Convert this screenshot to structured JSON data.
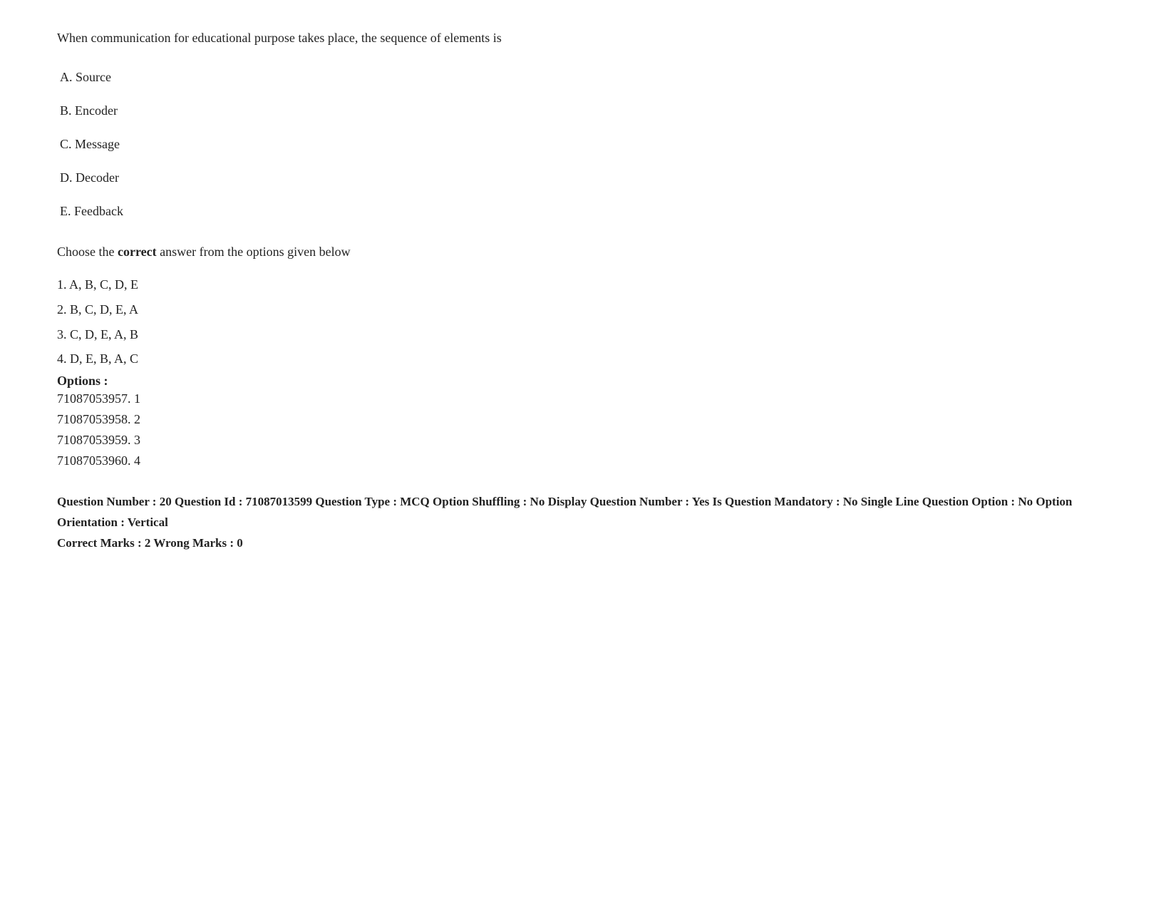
{
  "question": {
    "text": "When communication for educational purpose takes place, the sequence of elements is",
    "options": [
      {
        "label": "A.",
        "text": "Source"
      },
      {
        "label": "B.",
        "text": "Encoder"
      },
      {
        "label": "C.",
        "text": "Message"
      },
      {
        "label": "D.",
        "text": "Decoder"
      },
      {
        "label": "E.",
        "text": "Feedback"
      }
    ],
    "instruction_prefix": "Choose the ",
    "instruction_bold": "correct",
    "instruction_suffix": " answer from the options given below",
    "answer_choices": [
      {
        "num": "1.",
        "text": "A, B, C, D, E"
      },
      {
        "num": "2.",
        "text": "B, C, D, E, A"
      },
      {
        "num": "3.",
        "text": "C, D, E, A, B"
      },
      {
        "num": "4.",
        "text": "D, E, B, A, C"
      }
    ],
    "options_label": "Options :",
    "option_ids": [
      {
        "id": "71087053957.",
        "num": "1"
      },
      {
        "id": "71087053958.",
        "num": "2"
      },
      {
        "id": "71087053959.",
        "num": "3"
      },
      {
        "id": "71087053960.",
        "num": "4"
      }
    ],
    "metadata_line1": "Question Number : 20 Question Id : 71087013599 Question Type : MCQ Option Shuffling : No Display Question Number : Yes Is Question Mandatory : No Single Line Question Option : No Option Orientation : Vertical",
    "marks_line": "Correct Marks : 2 Wrong Marks : 0"
  }
}
